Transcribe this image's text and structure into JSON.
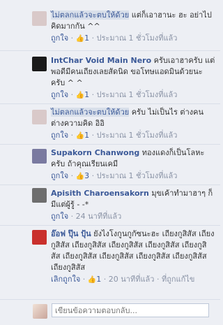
{
  "comments": [
    {
      "author": "ไม่ตลกแล้วจะตบให้ด้วย",
      "text": "แต่ก็เอาฮานะ ฮะ อย่าไปคิดมากกัน ^^",
      "unlike": "ถูกใจ",
      "likes": "1",
      "time": "ประมาณ 1 ชั่วโมงที่แล้ว",
      "avatar_color": "#d9c9c9"
    },
    {
      "author": "IntChar Void Main Nero",
      "text": "ครับเอาฮาครับ แต่พอดีมีคนเถียงเลยสัดนิด ขอโทษแอดมินด้วยนะครับ ^ ^",
      "unlike": "ถูกใจ",
      "likes": "1",
      "time": "ประมาณ 1 ชั่วโมงที่แล้ว",
      "avatar_color": "#1a1a1a"
    },
    {
      "author": "ไม่ตลกแล้วจะตบให้ด้วย",
      "text": "ครับ ไม่เป็นไร ต่างคนต่างความคิด อิอิ",
      "unlike": "ถูกใจ",
      "likes": "1",
      "time": "ประมาณ 1 ชั่วโมงที่แล้ว",
      "avatar_color": "#d9c9c9"
    },
    {
      "author": "Supakorn Chanwong",
      "text": "ทองแดงก็เป็นโลหะครับ ถ้าคุณเรียนเคมี",
      "unlike": "ถูกใจ",
      "likes": "3",
      "time": "ประมาณ 1 ชั่วโมงที่แล้ว",
      "avatar_color": "#7a7aa0"
    },
    {
      "author": "Apisith Charoensakorn",
      "text": "มุขเค้าทำมาฮาๆ ก็มีแต่ผู้รู้ - -*",
      "unlike": "ถูกใจ",
      "likes": "",
      "time": "24 นาทีที่แล้ว",
      "avatar_color": "#6e6e6e"
    },
    {
      "author": "อ๊อฟ ปุ๊น ปุ้น",
      "text": "ยังไงโงกูนกูกัซนะฮะ เถียงกูสิสัส เถียงกูสิสัส เถียงกูสิสัส เถียงกูสิสัส เถียงกูสิสัส เถียงกูสิสัส เถียงกูสิสัส เถียงกูสิสัส เถียงกูสิสัส เถียงกูสิสัส เถียงกูสิสัส",
      "unlike": "เลิกถูกใจ",
      "likes": "1",
      "time": "20 นาทีที่แล้ว",
      "extra": "ที่ถูกแก้ไข",
      "avatar_color": "#c9302c"
    }
  ],
  "reply": {
    "placeholder": "เขียนข้อความตอบกลับ..."
  }
}
